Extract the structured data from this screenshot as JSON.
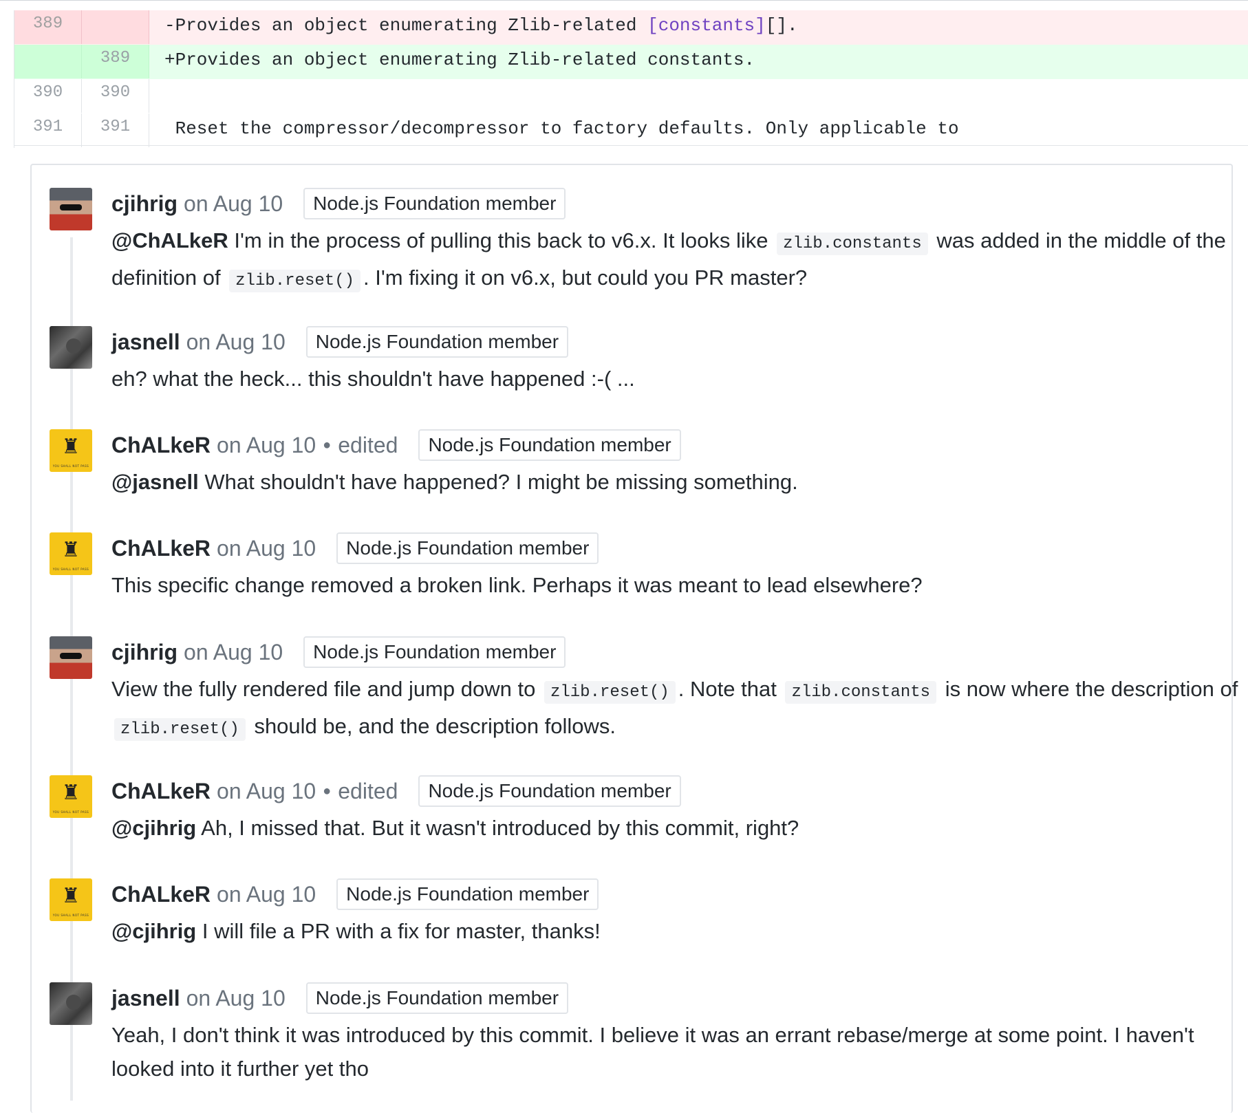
{
  "diff": {
    "rows": [
      {
        "old": "389",
        "new": "",
        "text": "-Provides an object enumerating Zlib-related ",
        "link": "[constants]",
        "after": "[]."
      },
      {
        "old": "",
        "new": "389",
        "text": "+Provides an object enumerating Zlib-related constants."
      },
      {
        "old": "390",
        "new": "390",
        "text": ""
      },
      {
        "old": "391",
        "new": "391",
        "text": " Reset the compressor/decompressor to factory defaults. Only applicable to"
      }
    ]
  },
  "comments": [
    {
      "author": "cjihrig",
      "when": "on Aug 10",
      "badge": "Node.js Foundation member",
      "p1": "@ChALkeR",
      "p2": " I'm in the process of pulling this back to v6.x. It looks like ",
      "c1": "zlib.constants",
      "p3": " was added in the middle of the definition of ",
      "c2": "zlib.reset()",
      "p4": ". I'm fixing it on v6.x, but could you PR master?"
    },
    {
      "author": "jasnell",
      "when": "on Aug 10",
      "badge": "Node.js Foundation member",
      "text": "eh? what the heck... this shouldn't have happened :-( ..."
    },
    {
      "author": "ChALkeR",
      "when": "on Aug 10",
      "edited": "edited",
      "badge": "Node.js Foundation member",
      "mention": "@jasnell",
      "text": " What shouldn't have happened? I might be missing something."
    },
    {
      "author": "ChALkeR",
      "when": "on Aug 10",
      "badge": "Node.js Foundation member",
      "text": "This specific change removed a broken link. Perhaps it was meant to lead elsewhere?"
    },
    {
      "author": "cjihrig",
      "when": "on Aug 10",
      "badge": "Node.js Foundation member",
      "p1": "View the fully rendered file and jump down to ",
      "c1": "zlib.reset()",
      "p2": ". Note that ",
      "c2": "zlib.constants",
      "p3": " is now where the description of ",
      "c3": "zlib.reset()",
      "p4": " should be, and the description follows."
    },
    {
      "author": "ChALkeR",
      "when": "on Aug 10",
      "edited": "edited",
      "badge": "Node.js Foundation member",
      "mention": "@cjihrig",
      "text": " Ah, I missed that. But it wasn't introduced by this commit, right?"
    },
    {
      "author": "ChALkeR",
      "when": "on Aug 10",
      "badge": "Node.js Foundation member",
      "mention": "@cjihrig",
      "text": " I will file a PR with a fix for master, thanks!"
    },
    {
      "author": "jasnell",
      "when": "on Aug 10",
      "badge": "Node.js Foundation member",
      "text": "Yeah, I don't think it was introduced by this commit. I believe it was an errant rebase/merge at some point. I haven't looked into it further yet tho"
    }
  ],
  "avatar_text": {
    "chalker_caption": "YOU SHALL NOT PASS",
    "chalker_glyph": "♜"
  },
  "colors": {
    "deleted_bg": "#ffeef0",
    "added_bg": "#e6ffed",
    "link": "#6f42c1"
  }
}
